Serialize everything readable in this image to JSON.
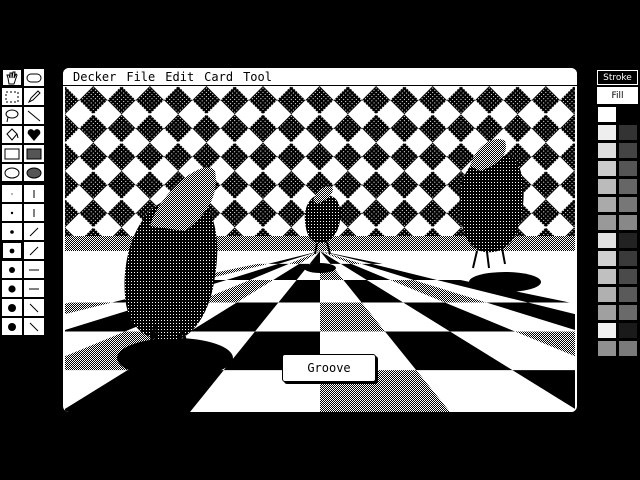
{
  "menubar": {
    "items": [
      "Decker",
      "File",
      "Edit",
      "Card",
      "Tool"
    ]
  },
  "canvas": {
    "button_label": "Groove"
  },
  "palette": {
    "stroke_label": "Stroke",
    "fill_label": "Fill"
  },
  "toolbar": {
    "tools": [
      "hand-icon",
      "oval-button-icon",
      "select-rect-icon",
      "pencil-icon",
      "lasso-icon",
      "line-icon",
      "bucket-icon",
      "heart-icon",
      "rect-icon",
      "filled-rect-icon",
      "ellipse-icon",
      "filled-ellipse-icon"
    ],
    "brushes": 16
  },
  "colors": {
    "background": "#000000",
    "paper": "#ffffff"
  }
}
